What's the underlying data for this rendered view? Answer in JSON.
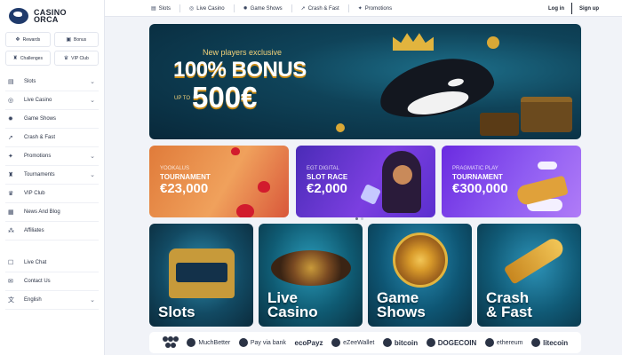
{
  "brand": {
    "name_line1": "CASINO",
    "name_line2": "ORCA"
  },
  "quick_links": [
    {
      "label": "Rewards",
      "icon": "gift-icon"
    },
    {
      "label": "Bonus",
      "icon": "bonus-icon"
    },
    {
      "label": "Challenges",
      "icon": "trophy-icon"
    },
    {
      "label": "VIP Club",
      "icon": "crown-icon"
    }
  ],
  "sidebar": {
    "items": [
      {
        "label": "Slots",
        "icon": "slot-icon",
        "expandable": true
      },
      {
        "label": "Live Casino",
        "icon": "live-icon",
        "expandable": true
      },
      {
        "label": "Game Shows",
        "icon": "gameshow-icon",
        "expandable": false
      },
      {
        "label": "Crash & Fast",
        "icon": "rocket-icon",
        "expandable": false
      },
      {
        "label": "Promotions",
        "icon": "promo-icon",
        "expandable": true
      },
      {
        "label": "Tournaments",
        "icon": "trophy-icon",
        "expandable": true
      },
      {
        "label": "VIP Club",
        "icon": "crown-icon",
        "expandable": false
      },
      {
        "label": "News And Blog",
        "icon": "news-icon",
        "expandable": false
      },
      {
        "label": "Affiliates",
        "icon": "affiliate-icon",
        "expandable": false
      }
    ],
    "bottom_items": [
      {
        "label": "Live Chat",
        "icon": "chat-icon",
        "expandable": false
      },
      {
        "label": "Contact Us",
        "icon": "mail-icon",
        "expandable": false
      },
      {
        "label": "English",
        "icon": "language-icon",
        "expandable": true
      }
    ]
  },
  "topbar": {
    "links": [
      {
        "label": "Slots",
        "icon": "slot-icon"
      },
      {
        "label": "Live Casino",
        "icon": "live-icon"
      },
      {
        "label": "Game Shows",
        "icon": "gameshow-icon"
      },
      {
        "label": "Crash & Fast",
        "icon": "rocket-icon"
      },
      {
        "label": "Promotions",
        "icon": "promo-icon"
      }
    ],
    "login": "Log in",
    "signup": "Sign up"
  },
  "hero": {
    "kicker": "New players exclusive",
    "headline": "100% BONUS",
    "upto": "UP TO",
    "amount": "500€"
  },
  "promos": [
    {
      "small": "TOURNAMENT",
      "title": "TOURNAMENT",
      "amount": "€23,000",
      "small_text": "YOOKALUS"
    },
    {
      "small": "EGT DIGITAL",
      "title": "SLOT RACE",
      "amount": "€2,000"
    },
    {
      "small": "PRAGMATIC PLAY",
      "title": "TOURNAMENT",
      "amount": "€300,000"
    }
  ],
  "categories": [
    {
      "label": "Slots"
    },
    {
      "label": "Live\nCasino"
    },
    {
      "label": "Game\nShows"
    },
    {
      "label": "Crash\n& Fast"
    }
  ],
  "payments": [
    {
      "label": "",
      "icon": "astropay-icon"
    },
    {
      "label": "MuchBetter",
      "icon": "muchbetter-icon"
    },
    {
      "label": "Pay via bank",
      "icon": "bank-icon"
    },
    {
      "label": "ecoPayz",
      "icon": ""
    },
    {
      "label": "eZeeWallet",
      "icon": "ezeewallet-icon"
    },
    {
      "label": "bitcoin",
      "icon": "bitcoin-icon"
    },
    {
      "label": "DOGECOIN",
      "icon": "dogecoin-icon"
    },
    {
      "label": "ethereum",
      "icon": "ethereum-icon"
    },
    {
      "label": "litecoin",
      "icon": "litecoin-icon"
    }
  ],
  "colors": {
    "sidebar_bg": "#ffffff",
    "page_bg": "#f1f3f8",
    "text_dark": "#1d2330",
    "hero_gold": "#f2d27a"
  }
}
